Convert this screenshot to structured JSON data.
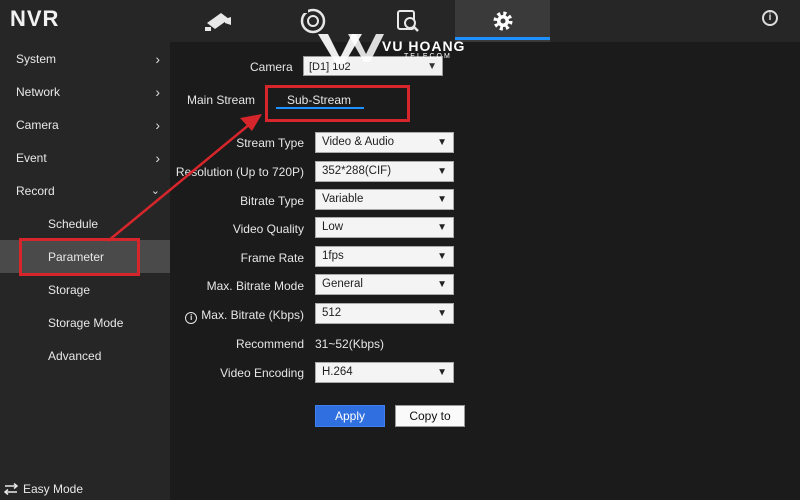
{
  "app": {
    "brand": "NVR"
  },
  "topbar": {
    "icons": [
      {
        "name": "camera-icon"
      },
      {
        "name": "playback-icon"
      },
      {
        "name": "search-icon"
      },
      {
        "name": "settings-icon",
        "active": true
      }
    ],
    "info": "i"
  },
  "sidebar": {
    "items": [
      {
        "label": "System"
      },
      {
        "label": "Network"
      },
      {
        "label": "Camera"
      },
      {
        "label": "Event"
      },
      {
        "label": "Record",
        "expanded": true
      }
    ],
    "sub_items": [
      {
        "label": "Schedule"
      },
      {
        "label": "Parameter",
        "active": true
      },
      {
        "label": "Storage"
      },
      {
        "label": "Storage Mode"
      },
      {
        "label": "Advanced"
      }
    ],
    "easy_mode": "Easy Mode"
  },
  "camera": {
    "label": "Camera",
    "value": "[D1] 102"
  },
  "tabs": {
    "main_stream": "Main Stream",
    "sub_stream": "Sub-Stream",
    "active": "Sub-Stream"
  },
  "form": {
    "stream_type": {
      "label": "Stream Type",
      "value": "Video & Audio"
    },
    "resolution": {
      "label": "Resolution (Up to 720P)",
      "value": "352*288(CIF)"
    },
    "bitrate_type": {
      "label": "Bitrate Type",
      "value": "Variable"
    },
    "video_quality": {
      "label": "Video Quality",
      "value": "Low"
    },
    "frame_rate": {
      "label": "Frame Rate",
      "value": "1fps"
    },
    "max_bitrate_mode": {
      "label": "Max. Bitrate Mode",
      "value": "General"
    },
    "max_bitrate": {
      "label": "Max. Bitrate (Kbps)",
      "value": "512"
    },
    "recommend": {
      "label": "Recommend",
      "value": "31~52(Kbps)"
    },
    "video_encoding": {
      "label": "Video Encoding",
      "value": "H.264"
    }
  },
  "buttons": {
    "apply": "Apply",
    "copy_to": "Copy to"
  },
  "watermark": {
    "title": "VU HOANG",
    "subtitle": "TELECOM"
  },
  "colors": {
    "accent": "#1e90ff",
    "apply": "#2f6fe0",
    "annotation": "#d7262b",
    "background": "#1b1b1b",
    "sidebar": "#262626"
  }
}
